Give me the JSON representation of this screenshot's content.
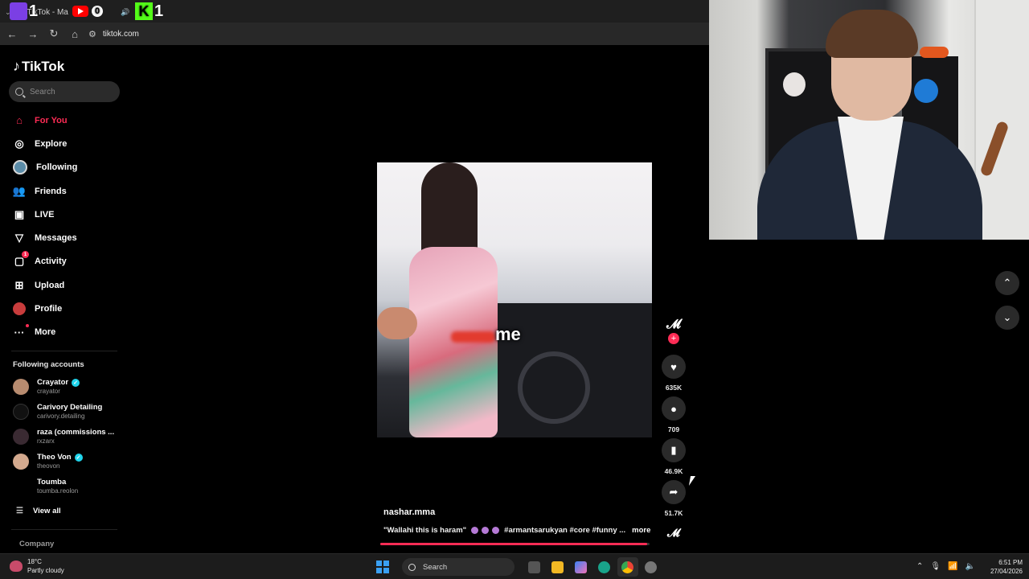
{
  "browser": {
    "tab_title": "TikTok - Ma",
    "url": "tiktok.com",
    "stream_overlay": {
      "twitch_count": "1",
      "youtube_count": "0",
      "kick_count": "1"
    }
  },
  "sidebar": {
    "logo": "TikTok",
    "search_placeholder": "Search",
    "nav": [
      {
        "label": "For You",
        "icon": "home-icon",
        "active": true
      },
      {
        "label": "Explore",
        "icon": "compass-icon"
      },
      {
        "label": "Following",
        "icon": "following-avatar-icon"
      },
      {
        "label": "Friends",
        "icon": "friends-icon"
      },
      {
        "label": "LIVE",
        "icon": "live-icon"
      },
      {
        "label": "Messages",
        "icon": "messages-icon"
      },
      {
        "label": "Activity",
        "icon": "activity-icon",
        "badge": "1"
      },
      {
        "label": "Upload",
        "icon": "upload-icon"
      },
      {
        "label": "Profile",
        "icon": "profile-avatar-icon"
      },
      {
        "label": "More",
        "icon": "more-icon"
      }
    ],
    "following_title": "Following accounts",
    "following": [
      {
        "name": "Crayator",
        "handle": "crayator",
        "verified": true
      },
      {
        "name": "Carivory Detailing",
        "handle": "carivory.detailing",
        "verified": false
      },
      {
        "name": "raza (commissions ...",
        "handle": "rxzarx",
        "verified": false
      },
      {
        "name": "Theo Von",
        "handle": "theovon",
        "verified": true
      },
      {
        "name": "Toumba",
        "handle": "toumba.reolon",
        "verified": false
      }
    ],
    "view_all": "View all",
    "company": "Company"
  },
  "video": {
    "overlay_text": "me",
    "username": "nashar.mma",
    "description": "\"Wallahi this is haram\"",
    "hashtags": "#armantsarukyan #core #funny ...",
    "more_label": "more",
    "progress": 0.99,
    "actions": {
      "likes": "635K",
      "comments": "709",
      "saves": "46.9K",
      "shares": "51.7K"
    }
  },
  "taskbar": {
    "temperature": "18°C",
    "weather": "Partly cloudy",
    "search_label": "Search",
    "time": "6:51 PM",
    "date": "27/04/2026"
  },
  "colors": {
    "accent": "#fe2c55",
    "verified": "#20d5ec",
    "background": "#000000"
  }
}
